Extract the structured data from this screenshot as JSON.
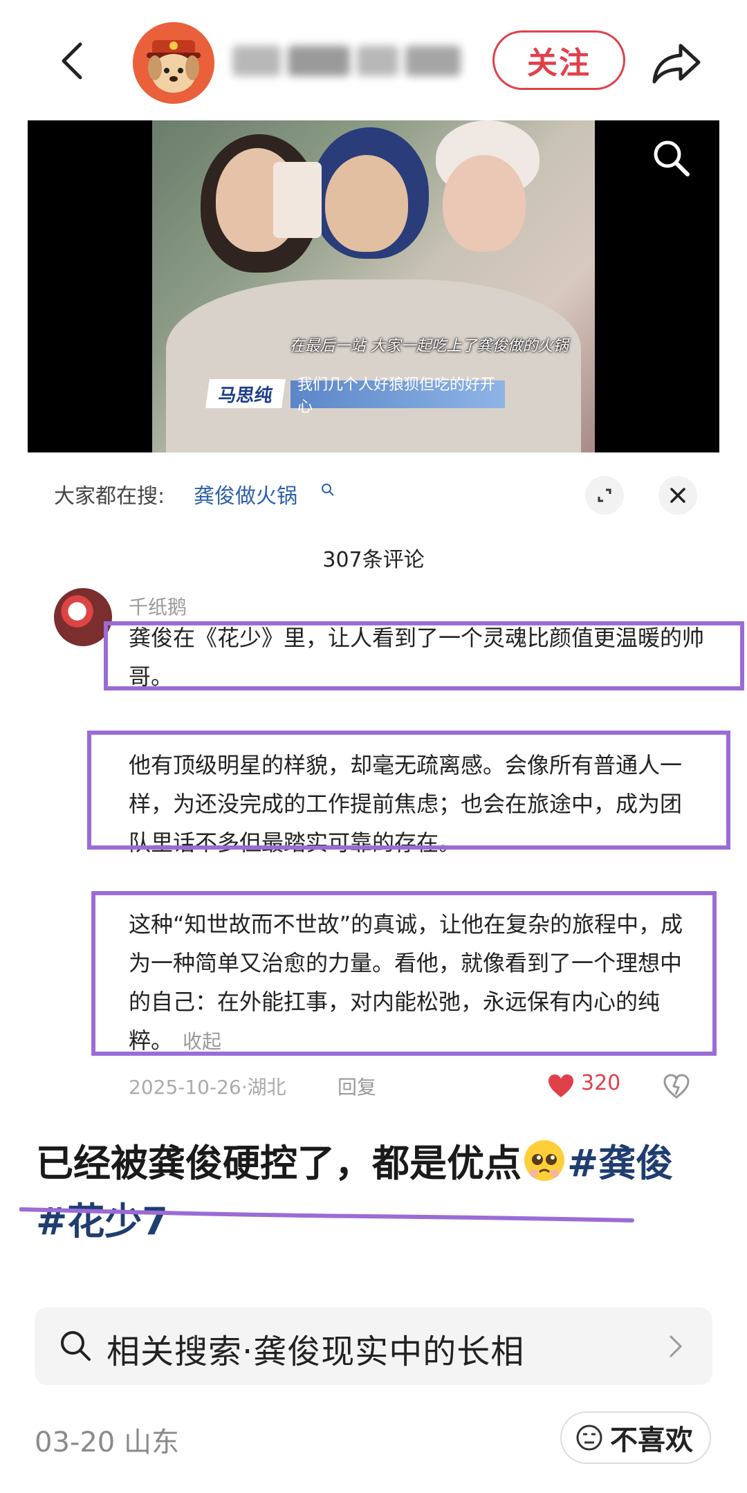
{
  "header": {
    "follow_label": "关注"
  },
  "video": {
    "subtitle_top": "在最后一站 大家一起吃上了龚俊做的火锅",
    "name_tag": "马思纯",
    "subtitle_bottom": "我们几个人好狼狈但吃的好开心"
  },
  "comments_panel": {
    "search_prefix": "大家都在搜:",
    "search_term": "龚俊做火锅",
    "count_label": "307条评论",
    "comment": {
      "username": "千纸鹅",
      "paragraph1": "龚俊在《花少》里，让人看到了一个灵魂比颜值更温暖的帅哥。",
      "paragraph2": "他有顶级明星的样貌，却毫无疏离感。会像所有普通人一样，为还没完成的工作提前焦虑；也会在旅途中，成为团队里话不多但最踏实可靠的存在。",
      "paragraph3": "这种“知世故而不世故”的真诚，让他在复杂的旅程中，成为一种简单又治愈的力量。看他，就像看到了一个理想中的自己：在外能扛事，对内能松弛，永远保有内心的纯粹。",
      "collapse_label": "收起",
      "meta": "2025-10-26·湖北",
      "reply_label": "回复",
      "likes": "320"
    }
  },
  "post": {
    "caption_text": "已经被龚俊硬控了，都是优点",
    "hashtags": "#龚俊#花少7",
    "related_search": "相关搜索·龚俊现实中的长相",
    "date_location": "03-20 山东",
    "dislike_label": "不喜欢"
  },
  "colors": {
    "accent_red": "#e0404a",
    "highlight_purple": "#9b6bd6",
    "hashtag_blue": "#1f3d70",
    "link_blue": "#2c5fa8"
  }
}
